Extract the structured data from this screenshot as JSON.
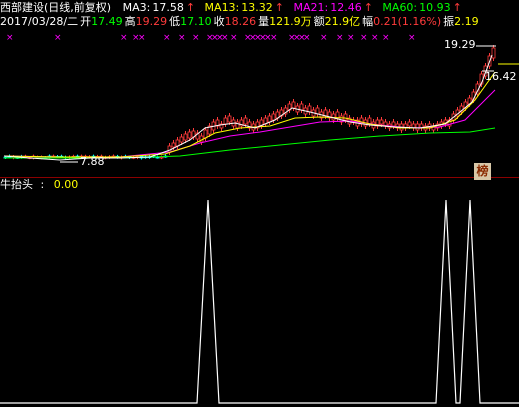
{
  "header": {
    "stock_name": "西部建设(日线,前复权)",
    "ma3_label": "MA3:",
    "ma3_value": "17.58",
    "ma13_label": "MA13:",
    "ma13_value": "13.32",
    "ma21_label": "MA21:",
    "ma21_value": "12.46",
    "ma60_label": "MA60:",
    "ma60_value": "10.93",
    "up_arrow": "↑"
  },
  "quote": {
    "date": "2017/03/28/二",
    "open_label": "开",
    "open": "17.49",
    "high_label": "高",
    "high": "19.29",
    "low_label": "低",
    "low": "17.10",
    "close_label": "收",
    "close": "18.26",
    "volume_label": "量",
    "volume": "121.9万",
    "amount_label": "额",
    "amount": "21.9亿",
    "change_label": "幅",
    "change": "0.21(1.16%)",
    "amplitude_label": "振",
    "amplitude": "2.19"
  },
  "price_labels": {
    "high_mark": "19.29",
    "right_mark": "16.42",
    "low_mark": "7.88"
  },
  "badge": {
    "text": "榜"
  },
  "indicator": {
    "name": "牛抬头",
    "separator": ":",
    "value": "0.00"
  },
  "colors": {
    "background": "#000000",
    "up": "#ff3b3b",
    "down": "#00ffff",
    "ma3": "#ffffff",
    "ma13": "#ffff00",
    "ma21": "#ff00ff",
    "ma60": "#00ff00",
    "marker": "#ff00ff",
    "indicator_line": "#ffffff",
    "divider": "#8b0000"
  }
}
